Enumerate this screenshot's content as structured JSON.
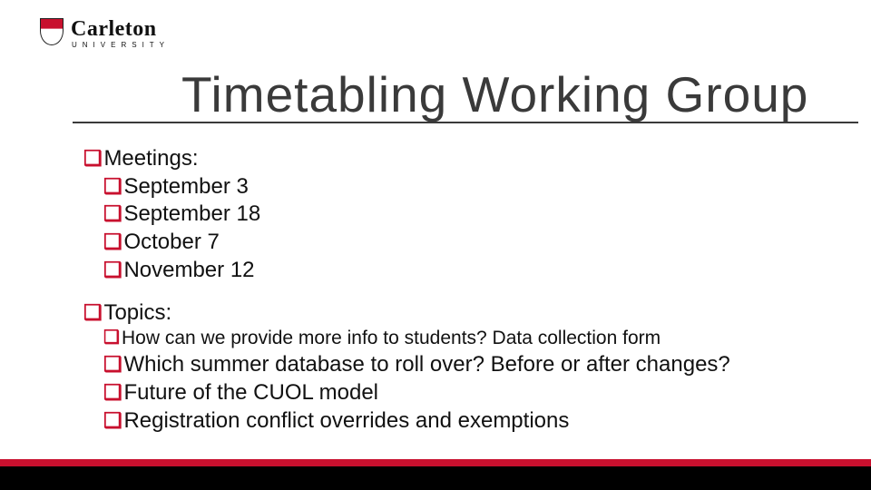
{
  "brand": {
    "wordmark": "Carleton",
    "subline": "UNIVERSITY"
  },
  "title": "Timetabling Working Group",
  "bullet_glyph": "❑",
  "sections": [
    {
      "heading": "Meetings:",
      "items": [
        {
          "text": "September 3",
          "small": false
        },
        {
          "text": "September 18",
          "small": false
        },
        {
          "text": "October 7",
          "small": false
        },
        {
          "text": "November 12",
          "small": false
        }
      ]
    },
    {
      "heading": "Topics:",
      "items": [
        {
          "text": "How can we provide more info to students? Data collection form",
          "small": true
        },
        {
          "text": "Which summer database to roll over? Before or after changes?",
          "small": false
        },
        {
          "text": "Future of the CUOL model",
          "small": false
        },
        {
          "text": "Registration conflict overrides and exemptions",
          "small": false
        }
      ]
    }
  ]
}
